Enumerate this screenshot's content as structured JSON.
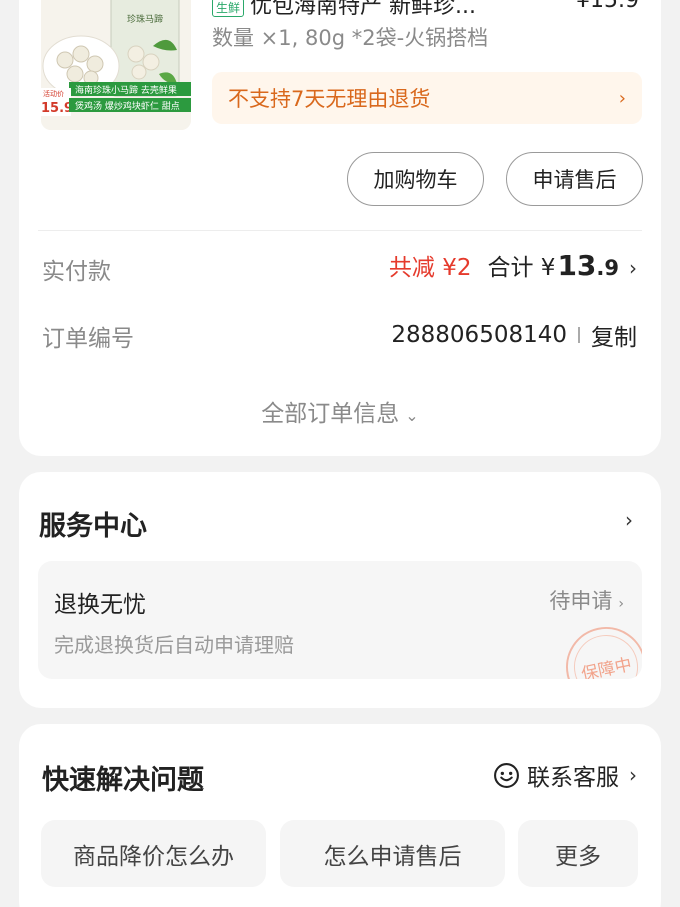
{
  "order": {
    "product": {
      "tag": "生鲜",
      "title": "优包海南特产 新鲜珍...",
      "price": "¥15.9",
      "spec": "数量 ×1, 80g *2袋-火锅搭档",
      "image_text": {
        "top_label": "珍珠马蹄",
        "banner": "海南珍珠小马蹄 去壳鲜果",
        "price_tag_top": "活动价",
        "price_tag": "15.9",
        "footer": "煲鸡汤 爆炒鸡块虾仁 甜点"
      }
    },
    "no_return_notice": "不支持7天无理由退货",
    "add_cart_label": "加购物车",
    "after_sales_label": "申请售后",
    "payment": {
      "label": "实付款",
      "discount": "共减 ¥2",
      "total_label": "合计 ¥",
      "total_integer": "13",
      "total_decimal": ".9"
    },
    "order_number": {
      "label": "订单编号",
      "value": "288806508140",
      "copy_label": "复制"
    },
    "all_info_label": "全部订单信息"
  },
  "service_center": {
    "title": "服务中心",
    "item": {
      "title": "退换无忧",
      "status": "待申请",
      "desc": "完成退换货后自动申请理赔",
      "stamp": "保障中"
    }
  },
  "quick_solve": {
    "title": "快速解决问题",
    "contact_label": "联系客服",
    "chips": [
      "商品降价怎么办",
      "怎么申请售后",
      "更多"
    ]
  },
  "colors": {
    "accent_red": "#e53a2c",
    "notice_orange": "#d9681c",
    "notice_bg": "#fff6ec",
    "page_bg": "#f2f2f2"
  },
  "icons": [
    "chevron-right-icon",
    "chevron-down-icon",
    "smile-icon"
  ]
}
